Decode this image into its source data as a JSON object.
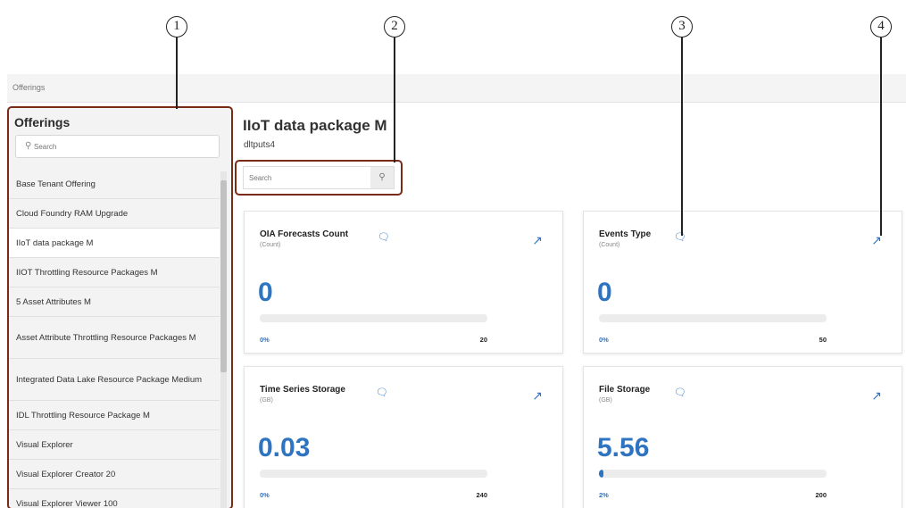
{
  "callouts": [
    "1",
    "2",
    "3",
    "4"
  ],
  "breadcrumb": "Offerings",
  "sidebar": {
    "title": "Offerings",
    "search_placeholder": "Search",
    "items": [
      {
        "label": "Base Tenant Offering"
      },
      {
        "label": "Cloud Foundry RAM Upgrade"
      },
      {
        "label": "IIoT data package M"
      },
      {
        "label": "IIOT Throttling Resource Packages M"
      },
      {
        "label": "5 Asset Attributes M"
      },
      {
        "label": "Asset Attribute Throttling Resource Packages M"
      },
      {
        "label": "Integrated Data Lake Resource Package Medium"
      },
      {
        "label": "IDL Throttling Resource Package M"
      },
      {
        "label": "Visual Explorer"
      },
      {
        "label": "Visual Explorer Creator 20"
      },
      {
        "label": "Visual Explorer Viewer 100"
      }
    ],
    "selected_index": 2
  },
  "main": {
    "title": "IIoT data package M",
    "subtitle": "dltputs4",
    "search_placeholder": "Search"
  },
  "cards": [
    {
      "title": "OIA Forecasts Count",
      "unit": "(Count)",
      "value": "0",
      "min_label": "0%",
      "max_label": "20",
      "fill_percent": 0
    },
    {
      "title": "Events Type",
      "unit": "(Count)",
      "value": "0",
      "min_label": "0%",
      "max_label": "50",
      "fill_percent": 0
    },
    {
      "title": "Time Series Storage",
      "unit": "(GB)",
      "value": "0.03",
      "min_label": "0%",
      "max_label": "240",
      "fill_percent": 0
    },
    {
      "title": "File Storage",
      "unit": "(GB)",
      "value": "5.56",
      "min_label": "2%",
      "max_label": "200",
      "fill_percent": 2
    }
  ],
  "icons": {
    "search": "search-icon",
    "comment": "comment-icon",
    "expand": "expand-icon"
  },
  "colors": {
    "accent": "#2f74c0",
    "highlight": "#7b2a16"
  }
}
